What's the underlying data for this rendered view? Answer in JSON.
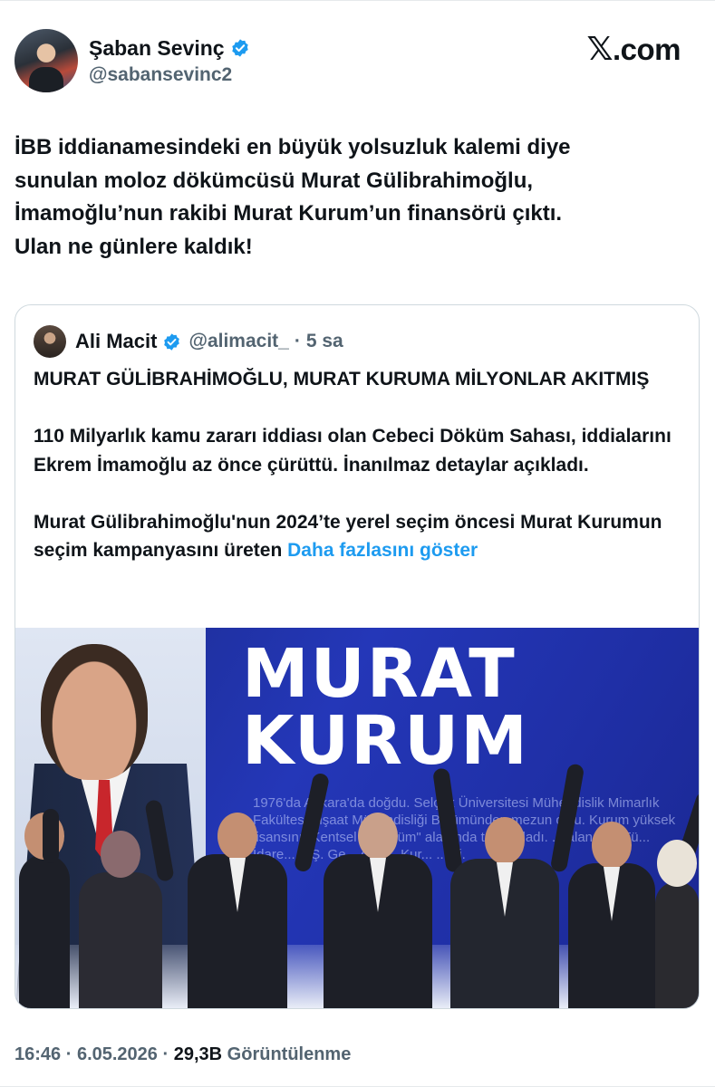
{
  "author": {
    "name": "Şaban Sevinç",
    "handle": "@sabansevinc2",
    "avatar_icon": "user-avatar",
    "verified_icon": "verified-badge-icon"
  },
  "brand": {
    "logo_x": "𝕏",
    "logo_text": ".com"
  },
  "tweet": {
    "text": "İBB iddianamesindeki en büyük yolsuzluk kalemi diye\nsunulan moloz dökümcüsü Murat Gülibrahimoğlu,\nİmamoğlu’nun rakibi Murat Kurum’un finansörü çıktı.\nUlan ne günlere kaldık!"
  },
  "quote": {
    "name": "Ali Macit",
    "handle": "@alimacit_",
    "separator": "·",
    "time": "5 sa",
    "paragraph1": "MURAT GÜLİBRAHİMOĞLU, MURAT KURUMA MİLYONLAR AKITMIŞ",
    "paragraph2": "110 Milyarlık kamu zararı iddiası olan Cebeci Döküm Sahası, iddialarını Ekrem İmamoğlu az önce çürüttü. İnanılmaz detaylar açıkladı.",
    "paragraph3": "Murat Gülibrahimoğlu'nun 2024’te yerel seçim öncesi Murat Kurumun seçim kampanyasını üreten",
    "show_more": "Daha fazlasını göster",
    "image": {
      "title_line1": "MURAT",
      "title_line2": "KURUM",
      "bio_text": "1976'da Ankara'da doğdu. Selçuk Üniversitesi Mühendislik Mimarlık Fakültesi İnşaat Mühendisliği Bölümünden mezun oldu. Kurum yüksek lisansını \"Kentsel dönüşüm\" alanında tamamladı. ... alanında Tü... İdare... A.Ş. Ge... ğü v... Kur... ... tti."
    }
  },
  "footer": {
    "time": "16:46",
    "sep1": "·",
    "date": "6.05.2026",
    "sep2": "·",
    "views_count": "29,3B",
    "views_label": "Görüntülenme"
  },
  "colors": {
    "link": "#1d9bf0",
    "text": "#0f1419",
    "secondary": "#536471",
    "border": "#cfd9de"
  }
}
